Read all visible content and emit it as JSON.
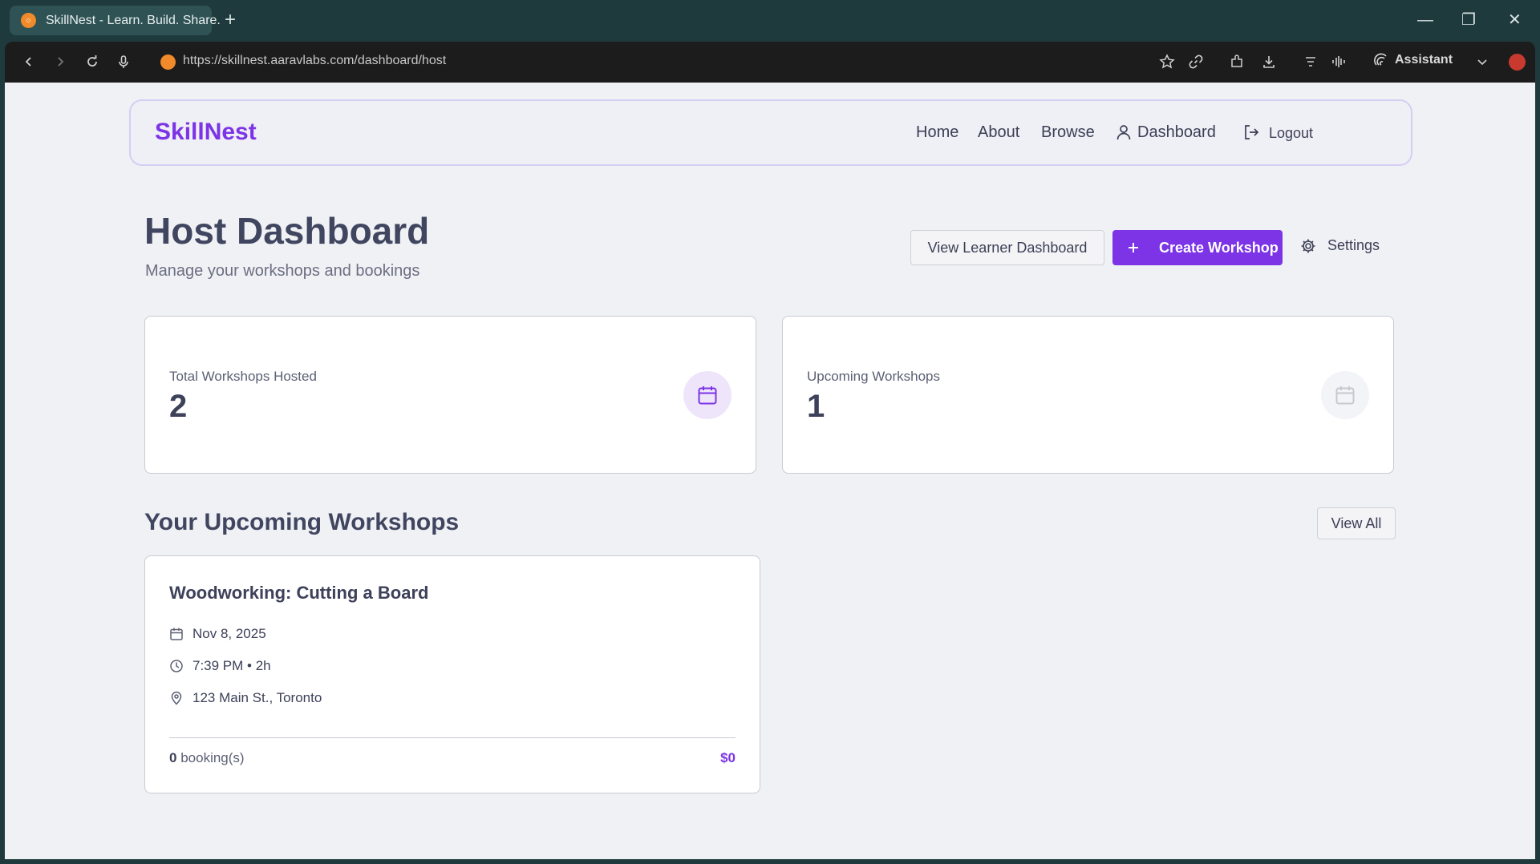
{
  "browser": {
    "tab_title": "SkillNest - Learn. Build. Share.",
    "url": "https://skillnest.aaravlabs.com/dashboard/host",
    "assistant_label": "Assistant"
  },
  "nav": {
    "brand": "SkillNest",
    "links": [
      "Home",
      "About",
      "Browse",
      "Dashboard"
    ],
    "logout": "Logout"
  },
  "header": {
    "title": "Host Dashboard",
    "subtitle": "Manage your workshops and bookings",
    "view_learner": "View Learner Dashboard",
    "create_workshop": "Create Workshop",
    "settings": "Settings"
  },
  "stats": [
    {
      "label": "Total Workshops Hosted",
      "value": "2"
    },
    {
      "label": "Upcoming Workshops",
      "value": "1"
    }
  ],
  "upcoming": {
    "title": "Your Upcoming Workshops",
    "view_all": "View All",
    "workshops": [
      {
        "title": "Woodworking: Cutting a Board",
        "date": "Nov 8, 2025",
        "time": "7:39 PM • 2h",
        "location": "123 Main St., Toronto",
        "bookings_count": "0",
        "bookings_label": "booking(s)",
        "price": "$0"
      }
    ]
  },
  "colors": {
    "accent": "#7c34e6",
    "text": "#3d4159",
    "page_bg": "#f0f1f5"
  }
}
